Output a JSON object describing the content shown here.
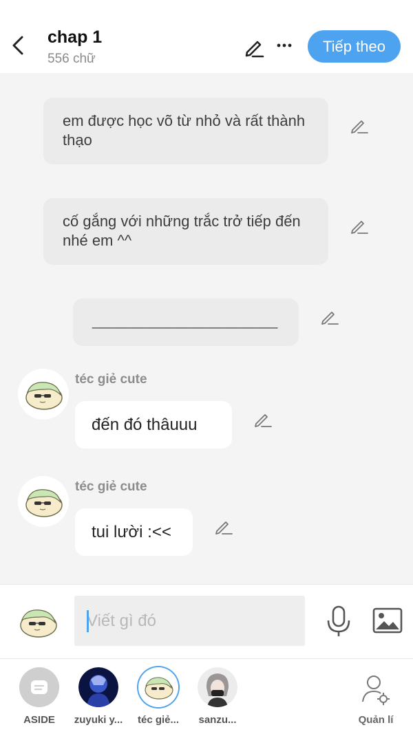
{
  "header": {
    "title": "chap 1",
    "word_count": "556 chữ",
    "next_label": "Tiếp theo"
  },
  "messages": [
    {
      "type": "narration",
      "text": "em được học võ từ nhỏ và rất thành thạo"
    },
    {
      "type": "narration",
      "text": "cố gắng với những trắc trở tiếp đến nhé em ^^"
    },
    {
      "type": "narration",
      "text": "______________________"
    },
    {
      "type": "chat",
      "sender": "téc giẻ cute",
      "text": "đến đó thâuuu"
    },
    {
      "type": "chat",
      "sender": "téc giẻ cute",
      "text": "tui lười :<<"
    }
  ],
  "composer": {
    "placeholder": "Viết gì đó"
  },
  "characters": [
    {
      "name": "ASIDE"
    },
    {
      "name": "zuyuki y..."
    },
    {
      "name": "téc giẻ..."
    },
    {
      "name": "sanzu..."
    }
  ],
  "manage_label": "Quản lí",
  "colors": {
    "accent": "#4da3f0",
    "narration_bg": "#ebebeb",
    "chat_bg": "#f4f4f5"
  }
}
